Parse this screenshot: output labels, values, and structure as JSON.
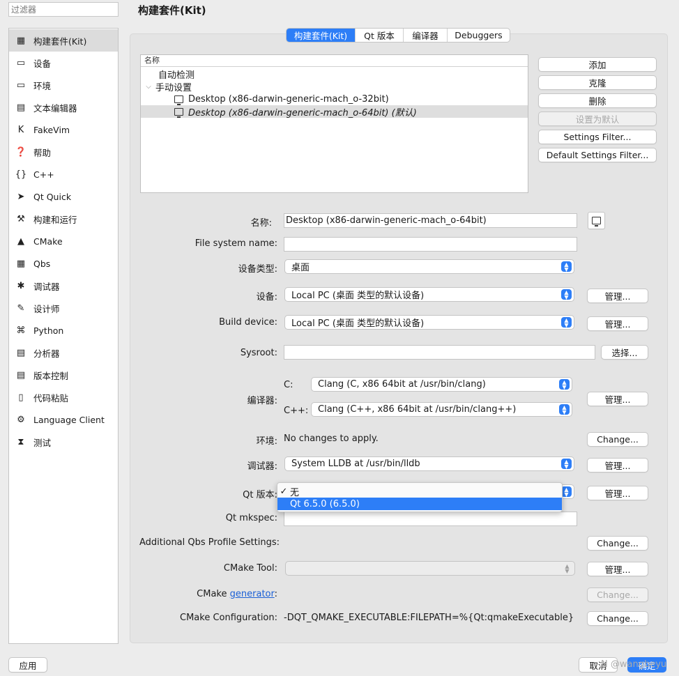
{
  "filter": {
    "placeholder": "过滤器"
  },
  "sidebar": {
    "items": [
      {
        "label": "构建套件(Kit)",
        "icon": "kit-icon",
        "glyph": "▦",
        "selected": true
      },
      {
        "label": "设备",
        "icon": "device-icon",
        "glyph": "▭"
      },
      {
        "label": "环境",
        "icon": "monitor-icon",
        "glyph": "▭"
      },
      {
        "label": "文本编辑器",
        "icon": "text-editor-icon",
        "glyph": "▤"
      },
      {
        "label": "FakeVim",
        "icon": "fakevim-icon",
        "glyph": "K"
      },
      {
        "label": "帮助",
        "icon": "help-icon",
        "glyph": "❓"
      },
      {
        "label": "C++",
        "icon": "cpp-icon",
        "glyph": "{}"
      },
      {
        "label": "Qt Quick",
        "icon": "qt-quick-icon",
        "glyph": "➤"
      },
      {
        "label": "构建和运行",
        "icon": "hammer-icon",
        "glyph": "⚒"
      },
      {
        "label": "CMake",
        "icon": "cmake-icon",
        "glyph": "▲"
      },
      {
        "label": "Qbs",
        "icon": "qbs-icon",
        "glyph": "▦"
      },
      {
        "label": "调试器",
        "icon": "bug-icon",
        "glyph": "✱"
      },
      {
        "label": "设计师",
        "icon": "pencil-icon",
        "glyph": "✎"
      },
      {
        "label": "Python",
        "icon": "python-icon",
        "glyph": "⌘"
      },
      {
        "label": "分析器",
        "icon": "analyzer-icon",
        "glyph": "▤"
      },
      {
        "label": "版本控制",
        "icon": "version-control-icon",
        "glyph": "▤"
      },
      {
        "label": "代码粘贴",
        "icon": "paste-icon",
        "glyph": "▯"
      },
      {
        "label": "Language Client",
        "icon": "language-client-icon",
        "glyph": "⚙"
      },
      {
        "label": "测试",
        "icon": "test-icon",
        "glyph": "⧗"
      }
    ]
  },
  "page": {
    "title": "构建套件(Kit)"
  },
  "tabs": [
    {
      "label": "构建套件(Kit)",
      "active": true
    },
    {
      "label": "Qt 版本"
    },
    {
      "label": "编译器"
    },
    {
      "label": "Debuggers"
    }
  ],
  "tree": {
    "header": "名称",
    "auto_detect": "自动检测",
    "manual": "手动设置",
    "kits": [
      "Desktop (x86-darwin-generic-mach_o-32bit)",
      "Desktop (x86-darwin-generic-mach_o-64bit) (默认)"
    ]
  },
  "buttons": {
    "add": "添加",
    "clone": "克隆",
    "remove": "删除",
    "set_default": "设置为默认",
    "settings_filter": "Settings Filter...",
    "default_settings_filter": "Default Settings Filter..."
  },
  "form": {
    "name_label": "名称:",
    "name_value": "Desktop (x86-darwin-generic-mach_o-64bit)",
    "fs_name_label": "File system name:",
    "fs_name_value": "",
    "device_type_label": "设备类型:",
    "device_type_value": "桌面",
    "device_label": "设备:",
    "device_value": "Local PC (桌面 类型的默认设备)",
    "build_device_label": "Build device:",
    "build_device_value": "Local PC (桌面 类型的默认设备)",
    "sysroot_label": "Sysroot:",
    "sysroot_value": "",
    "choose": "选择...",
    "compiler_label": "编译器:",
    "c_label": "C:",
    "c_value": "Clang (C, x86 64bit at /usr/bin/clang)",
    "cpp_label": "C++:",
    "cpp_value": "Clang (C++, x86 64bit at /usr/bin/clang++)",
    "env_label": "环境:",
    "env_value": "No changes to apply.",
    "debugger_label": "调试器:",
    "debugger_value": "System LLDB at /usr/bin/lldb",
    "qt_version_label": "Qt 版本:",
    "qt_mkspec_label": "Qt mkspec:",
    "qt_mkspec_value": "",
    "qbs_label": "Additional Qbs Profile Settings:",
    "cmake_tool_label": "CMake Tool:",
    "cmake_tool_value": "",
    "cmake_label_prefix": "CMake ",
    "cmake_generator_link": "generator",
    "cmake_label_suffix": ":",
    "cmake_config_label": "CMake Configuration:",
    "cmake_config_value": "-DQT_QMAKE_EXECUTABLE:FILEPATH=%{Qt:qmakeExecutable} -D...",
    "manage": "管理...",
    "change": "Change..."
  },
  "dropdown": {
    "options": [
      {
        "label": "无",
        "checked": true
      },
      {
        "label": "Qt 6.5.0 (6.5.0)",
        "highlighted": true
      }
    ]
  },
  "footer": {
    "apply": "应用",
    "cancel": "取消",
    "ok": "确定",
    "watermark": "N @wangbeyu"
  },
  "colors": {
    "accent": "#2d7ef7",
    "link": "#1a5fd6"
  }
}
